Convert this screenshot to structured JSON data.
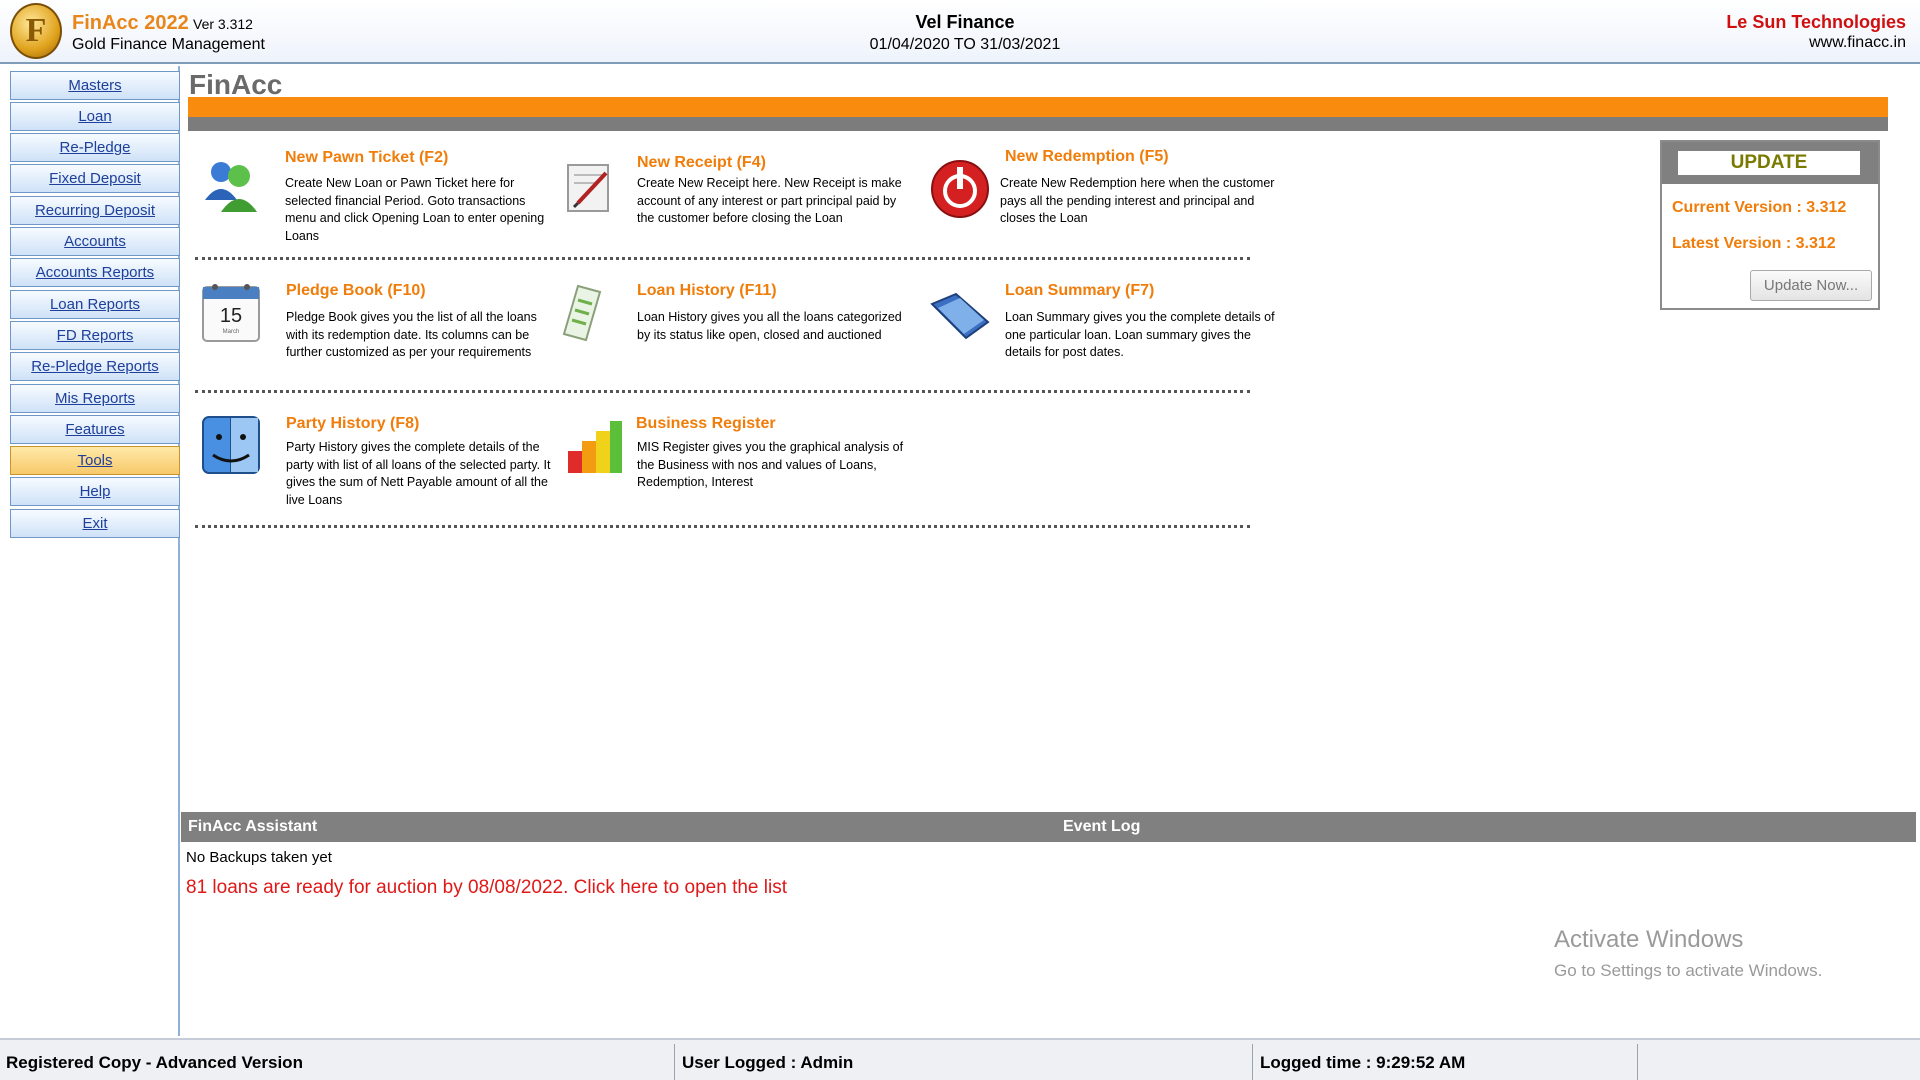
{
  "header": {
    "app_title": "FinAcc 2022",
    "version": "Ver 3.312",
    "subtitle": "Gold Finance Management",
    "logo_letter": "F",
    "company": "Vel Finance",
    "period": "01/04/2020 TO 31/03/2021",
    "vendor": "Le Sun Technologies",
    "vendor_url": "www.finacc.in"
  },
  "sidebar": {
    "items": [
      {
        "label": "Masters"
      },
      {
        "label": "Loan"
      },
      {
        "label": "Re-Pledge"
      },
      {
        "label": "Fixed Deposit"
      },
      {
        "label": "Recurring Deposit"
      },
      {
        "label": "Accounts"
      },
      {
        "label": "Accounts Reports"
      },
      {
        "label": "Loan Reports"
      },
      {
        "label": "FD Reports"
      },
      {
        "label": "Re-Pledge Reports"
      },
      {
        "label": "Mis Reports"
      },
      {
        "label": "Features"
      },
      {
        "label": "Tools",
        "active": true
      },
      {
        "label": "Help"
      },
      {
        "label": "Exit"
      }
    ]
  },
  "main": {
    "title": "FinAcc",
    "features": [
      {
        "title": "New Pawn Ticket (F2)",
        "icon": "users-icon",
        "description": "Create New Loan or Pawn Ticket here for selected financial Period. Goto transactions menu and click Opening Loan to enter opening Loans"
      },
      {
        "title": "New Receipt (F4)",
        "icon": "receipt-pen-icon",
        "description": "Create New Receipt here. New Receipt is make account of any interest or part principal paid by the customer before closing the Loan"
      },
      {
        "title": "New Redemption (F5)",
        "icon": "power-icon",
        "description": "Create New Redemption here when the customer pays all the pending interest and principal and closes the Loan"
      },
      {
        "title": "Pledge Book (F10)",
        "icon": "calendar-icon",
        "calendar_day": "15",
        "calendar_month": "March",
        "description": "Pledge Book gives you the list of all the loans with its redemption date. Its columns can be further customized as per your requirements"
      },
      {
        "title": "Loan History (F11)",
        "icon": "notepad-icon",
        "description": "Loan History gives you all the loans categorized by its status like open, closed and auctioned"
      },
      {
        "title": "Loan Summary (F7)",
        "icon": "folder-icon",
        "description": "Loan Summary gives you the complete details of one particular loan. Loan summary gives the details for post dates."
      },
      {
        "title": "Party History (F8)",
        "icon": "finder-face-icon",
        "description": "Party History gives the complete details of the party with list of all loans of the selected party. It gives the sum of Nett Payable amount of all the live Loans"
      },
      {
        "title": "Business Register",
        "icon": "bar-chart-icon",
        "description": "MIS Register gives you the graphical analysis of the Business with nos and values of Loans, Redemption, Interest"
      }
    ]
  },
  "update_panel": {
    "title": "UPDATE",
    "current_version": "Current Version : 3.312",
    "latest_version": "Latest Version : 3.312",
    "button": "Update Now..."
  },
  "bottom": {
    "assistant_title": "FinAcc Assistant",
    "event_log_title": "Event Log",
    "backup_message": "No Backups taken yet",
    "auction_message": "81 loans are ready for auction by 08/08/2022. Click here to open the list",
    "watermark_title": "Activate Windows",
    "watermark_subtitle": "Go to Settings to activate Windows."
  },
  "statusbar": {
    "registration": "Registered Copy - Advanced Version",
    "user": "User Logged : Admin",
    "logged_time": "Logged time : 9:29:52 AM",
    "extra": ""
  },
  "colors": {
    "accent_orange": "#f98b0f",
    "title_orange": "#f07d0a",
    "alert_red": "#e01818",
    "nav_active": "#f7c96a",
    "nav_blue": "#cfe2f8"
  }
}
